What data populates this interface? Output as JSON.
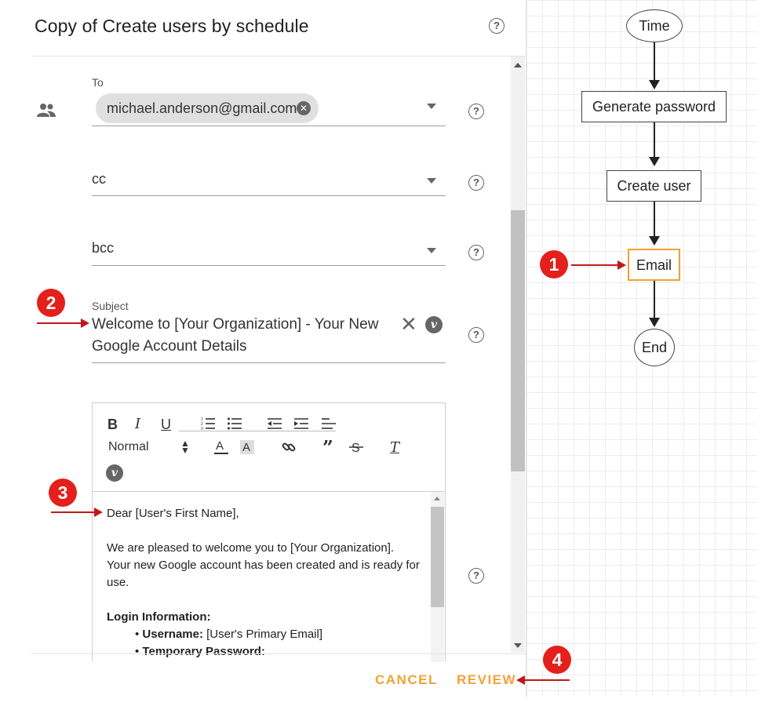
{
  "dialog": {
    "title": "Copy of Create users by schedule",
    "to": {
      "label": "To",
      "chip": "michael.anderson@gmail.com",
      "chip_remove_icon": "close-icon"
    },
    "cc": {
      "value": "cc"
    },
    "bcc": {
      "value": "bcc"
    },
    "subject": {
      "label": "Subject",
      "value": "Welcome to [Your Organization] - Your New Google Account Details"
    },
    "variable_badge": "v",
    "help_glyph": "?",
    "editor": {
      "toolbar": {
        "bold": "B",
        "italic": "I",
        "underline": "U",
        "format": "Normal",
        "quote": "”",
        "clear": "T",
        "variable": "v"
      },
      "body": {
        "greeting": "Dear [User's First Name],",
        "intro": "We are pleased to welcome you to [Your Organization]. Your new Google account has been created and is ready for use.",
        "login_heading": "Login Information:",
        "username_label": "Username:",
        "username_value": " [User's Primary Email]",
        "password_label": "Temporary Password:"
      }
    },
    "buttons": {
      "cancel": "CANCEL",
      "review": "REVIEW"
    }
  },
  "flow": {
    "nodes": {
      "time": "Time",
      "generate": "Generate password",
      "create": "Create user",
      "email": "Email",
      "end": "End"
    },
    "selected_color": "#f2a030"
  },
  "annotations": {
    "one": "1",
    "two": "2",
    "three": "3",
    "four": "4",
    "color": "#e3201b"
  }
}
